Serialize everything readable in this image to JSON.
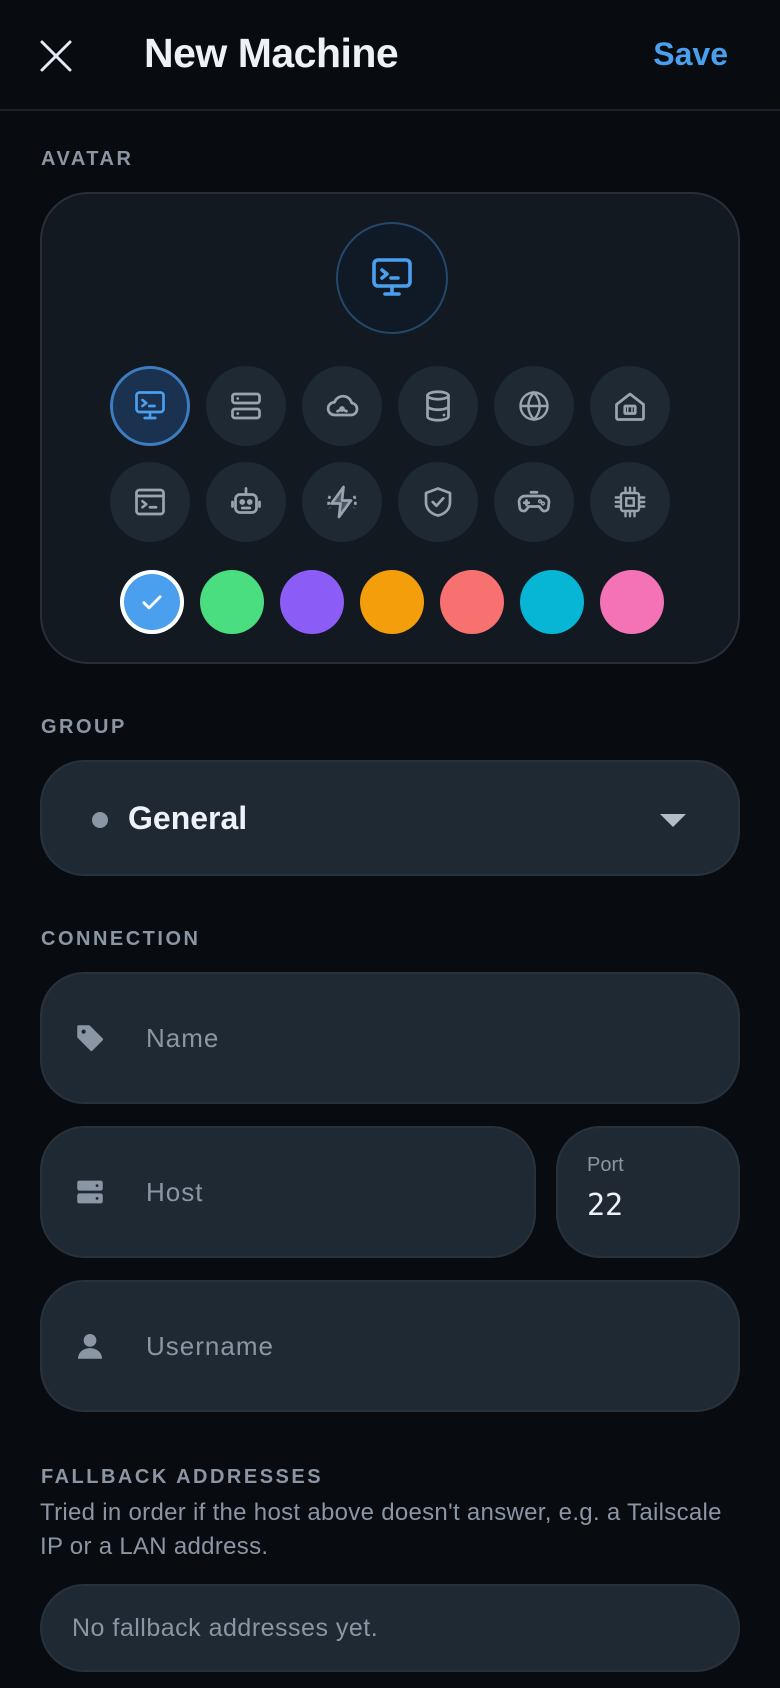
{
  "header": {
    "title": "New Machine",
    "save_label": "Save"
  },
  "avatar": {
    "section_label": "AVATAR",
    "selected_icon": "monitor-terminal-icon",
    "icons": [
      [
        "monitor-terminal-icon",
        "server-icon",
        "cloud-icon",
        "database-icon",
        "globe-icon",
        "home-icon"
      ],
      [
        "terminal-window-icon",
        "robot-icon",
        "lightning-icon",
        "shield-check-icon",
        "gamepad-icon",
        "cpu-chip-icon"
      ]
    ],
    "colors": [
      "#4a9fee",
      "#4ade80",
      "#8b5cf6",
      "#f59e0b",
      "#f87171",
      "#06b6d4",
      "#f472b6"
    ],
    "selected_color": "#4a9fee",
    "accent": "#4a9fee"
  },
  "group": {
    "section_label": "GROUP",
    "value": "General"
  },
  "connection": {
    "section_label": "CONNECTION",
    "name_placeholder": "Name",
    "host_placeholder": "Host",
    "port_label": "Port",
    "port_value": "22",
    "username_placeholder": "Username"
  },
  "fallback": {
    "section_label": "FALLBACK ADDRESSES",
    "description": "Tried in order if the host above doesn't answer, e.g. a Tailscale IP or a LAN address.",
    "empty_text": "No fallback addresses yet."
  }
}
